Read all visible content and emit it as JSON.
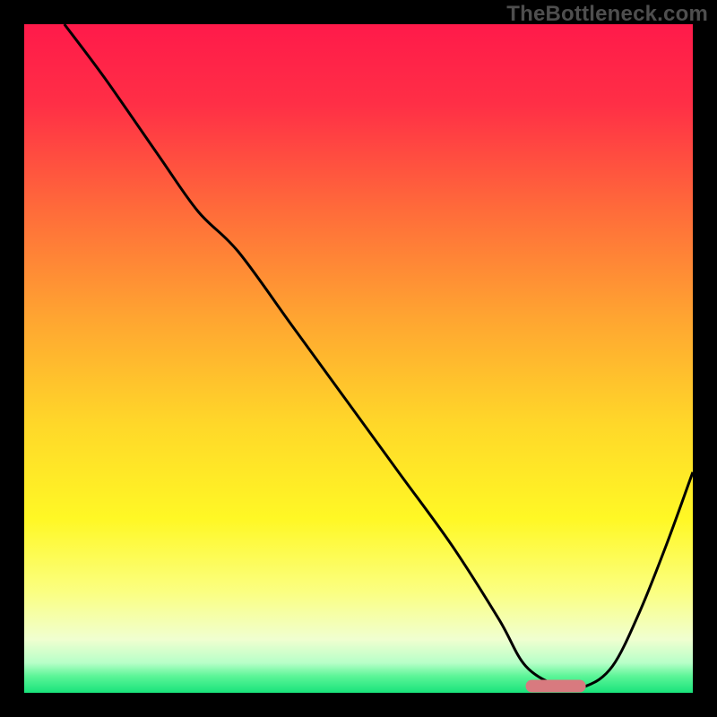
{
  "watermark": "TheBottleneck.com",
  "chart_data": {
    "type": "line",
    "title": "",
    "xlabel": "",
    "ylabel": "",
    "xlim": [
      0,
      100
    ],
    "ylim": [
      0,
      100
    ],
    "background_gradient": {
      "stops": [
        {
          "offset": 0.0,
          "color": "#ff1a4a"
        },
        {
          "offset": 0.12,
          "color": "#ff2f46"
        },
        {
          "offset": 0.28,
          "color": "#ff6c3a"
        },
        {
          "offset": 0.44,
          "color": "#ffa531"
        },
        {
          "offset": 0.6,
          "color": "#ffd829"
        },
        {
          "offset": 0.74,
          "color": "#fff825"
        },
        {
          "offset": 0.85,
          "color": "#fbff82"
        },
        {
          "offset": 0.92,
          "color": "#f0ffd0"
        },
        {
          "offset": 0.955,
          "color": "#b8ffc8"
        },
        {
          "offset": 0.975,
          "color": "#5cf598"
        },
        {
          "offset": 1.0,
          "color": "#19e37b"
        }
      ]
    },
    "series": [
      {
        "name": "bottleneck-curve",
        "color": "#000000",
        "x": [
          6,
          12,
          20,
          26,
          32,
          40,
          48,
          56,
          64,
          71,
          75,
          80,
          84,
          88,
          92,
          96,
          100
        ],
        "values": [
          100,
          92,
          80.5,
          72,
          66,
          55,
          44,
          33,
          22,
          11,
          4,
          1,
          1,
          4,
          12,
          22,
          33
        ]
      }
    ],
    "marker": {
      "name": "optimal-zone",
      "shape": "pill",
      "color": "#d87a7f",
      "x_start": 75,
      "x_end": 84,
      "y": 1
    }
  }
}
